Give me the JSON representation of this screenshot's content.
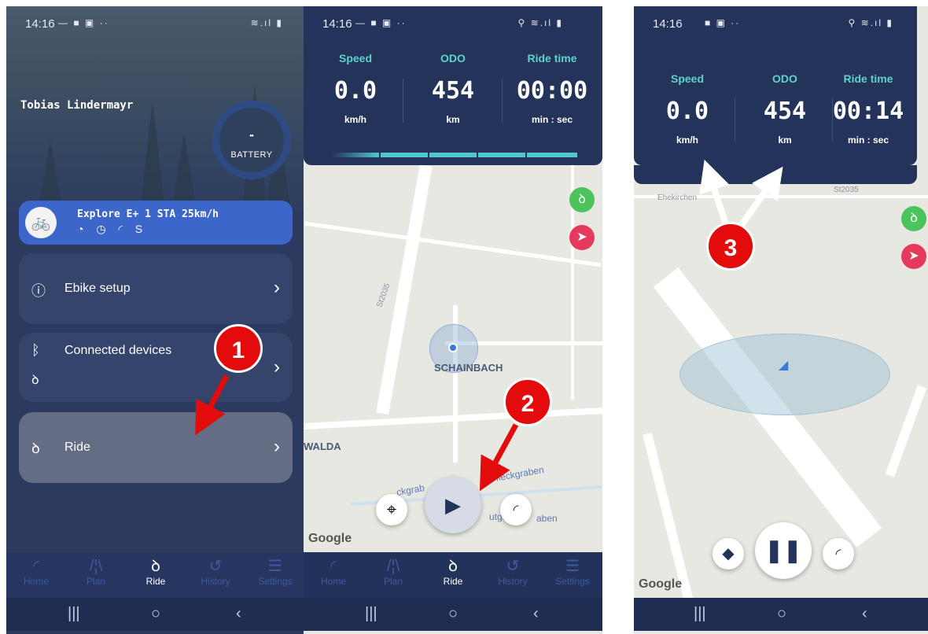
{
  "panel1": {
    "status": {
      "time": "14:16",
      "icons_left": "— ■ ▣ ··",
      "icons_right": "≋.ıl ▮"
    },
    "user_name": "Tobias Lindermayr",
    "battery": {
      "value": "-",
      "label": "BATTERY"
    },
    "bike": {
      "name": "Explore E+ 1 STA 25km/h",
      "feature_icons": "◔ ◷ ◜ S"
    },
    "menu": [
      {
        "label": "Ebike setup",
        "icon": "info-icon"
      },
      {
        "label": "Connected devices",
        "icon": "bluetooth-icon"
      },
      {
        "label": "Ride",
        "icon": "bike-icon"
      }
    ]
  },
  "nav": {
    "items": [
      {
        "label": "Home",
        "icon": "speedometer-icon"
      },
      {
        "label": "Plan",
        "icon": "route-icon"
      },
      {
        "label": "Ride",
        "icon": "bike-icon"
      },
      {
        "label": "History",
        "icon": "history-icon"
      },
      {
        "label": "Settings",
        "icon": "sliders-icon"
      }
    ],
    "active": "Ride"
  },
  "panel2": {
    "status": {
      "time": "14:16",
      "icons_left": "— ■ ▣ ··",
      "icons_right": "⚲ ≋.ıl ▮"
    },
    "stats": [
      {
        "header": "Speed",
        "value": "0.0",
        "unit": "km/h"
      },
      {
        "header": "ODO",
        "value": "454",
        "unit": "km"
      },
      {
        "header": "Ride time",
        "value": "00:00",
        "unit": "min : sec"
      }
    ],
    "map": {
      "place": "SCHAINBACH",
      "road": "St2035",
      "left_label": "WALDA",
      "stream_1": "Pfleckgraben",
      "stream_2": "ckgrab",
      "stream_3": "utgab",
      "stream_4": "aben",
      "logo": "Google"
    }
  },
  "panel3": {
    "status": {
      "time": "14:16",
      "icons_left": "■ ▣ ··",
      "icons_right": "⚲ ≋.ıl ▮"
    },
    "stats": [
      {
        "header": "Speed",
        "value": "0.0",
        "unit": "km/h"
      },
      {
        "header": "ODO",
        "value": "454",
        "unit": "km"
      },
      {
        "header": "Ride time",
        "value": "00:14",
        "unit": "min : sec"
      }
    ],
    "map": {
      "place": "Ehekirchen",
      "road": "St2035",
      "logo": "Google"
    }
  },
  "annotations": {
    "step1": "1",
    "step2": "2",
    "step3": "3"
  },
  "colors": {
    "navy": "#24335a",
    "accent_teal": "#5ed2cf",
    "annotation_red": "#e30b0b",
    "bike_green": "#4cc35b",
    "nav_pink": "#e63a5c"
  }
}
